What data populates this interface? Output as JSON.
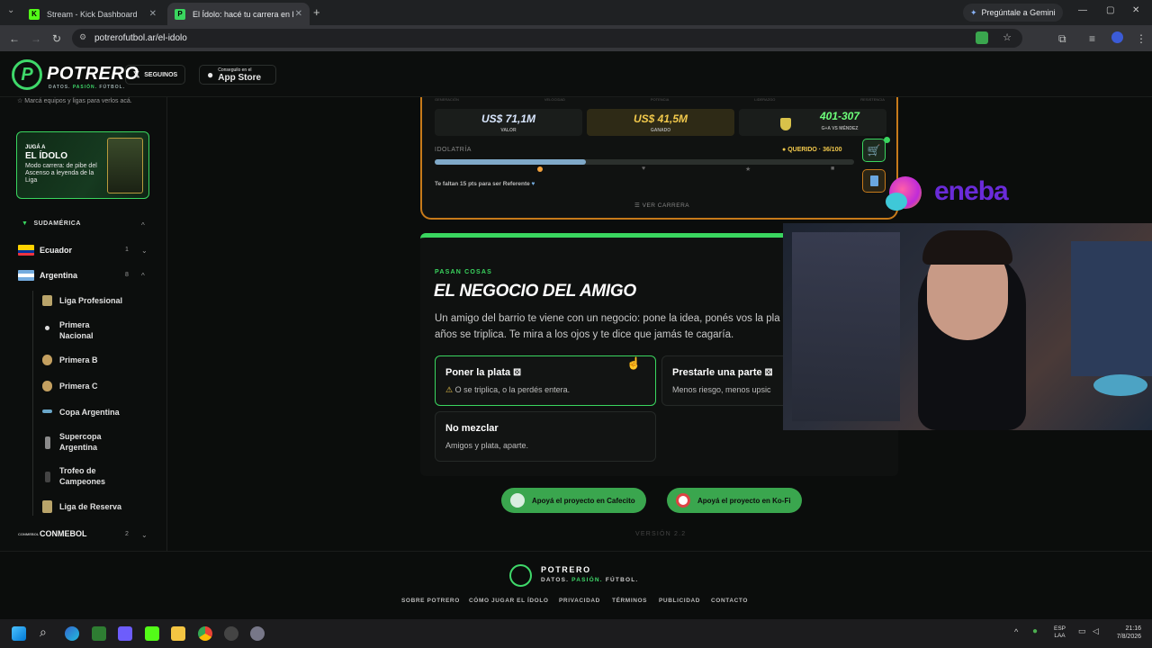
{
  "browser": {
    "tabs": [
      {
        "title": "Stream - Kick Dashboard",
        "favicon": "K"
      },
      {
        "title": "El Ídolo: hacé tu carrera en la Li",
        "favicon": "P"
      }
    ],
    "url": "potrerofutbol.ar/el-idolo",
    "gemini": "Pregúntale a Gemini"
  },
  "header": {
    "logo_letter": "P",
    "brand": "POTRERO",
    "tagline_1": "DATOS.",
    "tagline_2": "PASIÓN.",
    "tagline_3": "FÚTBOL.",
    "x_button": "SEGUINOS",
    "appstore_small": "Conseguilo en el",
    "appstore_big": "App Store"
  },
  "sidebar": {
    "hint": "Marcá equipos y ligas para verlos acá.",
    "promo": {
      "small": "JUGÁ A",
      "title": "EL ÍDOLO",
      "desc": "Modo carrera: de pibe del Ascenso a leyenda de la Liga"
    },
    "region": "SUDAMÉRICA",
    "countries": [
      {
        "name": "Ecuador",
        "count": "1"
      },
      {
        "name": "Argentina",
        "count": "8"
      }
    ],
    "leagues": [
      "Liga Profesional",
      "Primera Nacional",
      "Primera B",
      "Primera C",
      "Copa Argentina",
      "Supercopa Argentina",
      "Trofeo de Campeones",
      "Liga de Reserva"
    ],
    "conmebol": {
      "name": "CONMEBOL",
      "count": "2",
      "logo_text": "CONMEBOL"
    }
  },
  "career": {
    "tiny_labels": [
      "GENERACIÓN",
      "VELOCIDAD",
      "POTENCIA",
      "LIDERAZGO",
      "RESISTENCIA"
    ],
    "stats": [
      {
        "value": "US$ 71,1M",
        "label": "VALOR"
      },
      {
        "value": "US$ 41,5M",
        "label": "GANADO"
      },
      {
        "value": "401-307",
        "label": "G+A VS MÉNDEZ"
      }
    ],
    "idolatria_label": "IDOLATRÍA",
    "idolatria_status": "QUERIDO · 36/100",
    "idolatria_progress": 0.36,
    "hint": "Te faltan 15 pts para ser Referente",
    "ver_carrera": "VER CARRERA"
  },
  "event": {
    "kicker": "PASAN COSAS",
    "title": "EL NEGOCIO DEL AMIGO",
    "body_1": "Un amigo del barrio te viene con un negocio: pone la idea, ponés vos la pla",
    "body_2": "años se triplica. Te mira a los ojos y te dice que jamás te cagaría.",
    "options": [
      {
        "title": "Poner la plata",
        "desc": "O se triplica, o la perdés entera."
      },
      {
        "title": "Prestarle una parte",
        "desc": "Menos riesgo, menos upsic"
      },
      {
        "title": "No mezclar",
        "desc": "Amigos y plata, aparte."
      }
    ]
  },
  "support": {
    "cafecito": "Apoyá el proyecto en Cafecito",
    "kofi": "Apoyá el proyecto en Ko-Fi",
    "version": "VERSIÓN 2.2"
  },
  "overlay": {
    "brand": "eneba"
  },
  "footer": {
    "brand": "POTRERO",
    "tagline_1": "DATOS.",
    "tagline_2": "PASIÓN.",
    "tagline_3": "FÚTBOL.",
    "links": [
      "SOBRE POTRERO",
      "CÓMO JUGAR EL ÍDOLO",
      "PRIVACIDAD",
      "TÉRMINOS",
      "PUBLICIDAD",
      "CONTACTO"
    ]
  },
  "taskbar": {
    "lang_1": "ESP",
    "lang_2": "LAA",
    "time": "21:16",
    "date": "7/8/2026"
  },
  "colors": {
    "accent": "#3ad65f",
    "gold": "#c77a1a",
    "ink": "#0b0d0c"
  }
}
